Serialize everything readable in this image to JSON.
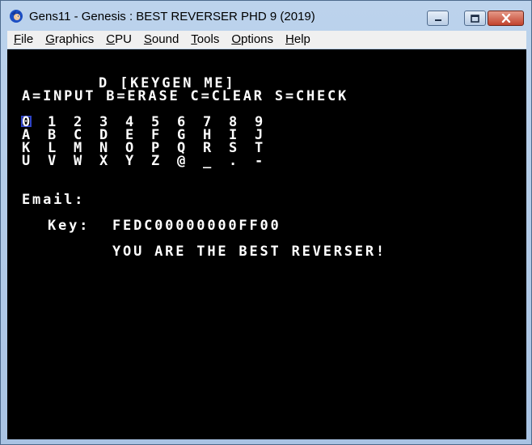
{
  "window": {
    "title": "Gens11 - Genesis : BEST REVERSER PHD 9 (2019)"
  },
  "menu": [
    {
      "mnemonic": "F",
      "rest": "ile"
    },
    {
      "mnemonic": "G",
      "rest": "raphics"
    },
    {
      "mnemonic": "C",
      "rest": "PU"
    },
    {
      "mnemonic": "S",
      "rest": "ound"
    },
    {
      "mnemonic": "T",
      "rest": "ools"
    },
    {
      "mnemonic": "O",
      "rest": "ptions"
    },
    {
      "mnemonic": "H",
      "rest": "elp"
    }
  ],
  "game": {
    "header": "D [KEYGEN ME]",
    "controls": "A=INPUT B=ERASE C=CLEAR S=CHECK",
    "charset_rows": [
      [
        "0",
        "1",
        "2",
        "3",
        "4",
        "5",
        "6",
        "7",
        "8",
        "9"
      ],
      [
        "A",
        "B",
        "C",
        "D",
        "E",
        "F",
        "G",
        "H",
        "I",
        "J"
      ],
      [
        "K",
        "L",
        "M",
        "N",
        "O",
        "P",
        "Q",
        "R",
        "S",
        "T"
      ],
      [
        "U",
        "V",
        "W",
        "X",
        "Y",
        "Z",
        "@",
        "_",
        ".",
        "-"
      ]
    ],
    "email_label": "Email:",
    "email_value": "",
    "key_label": "Key:",
    "key_value": "FEDC00000000FF00",
    "result_message": "YOU ARE THE BEST REVERSER!"
  }
}
